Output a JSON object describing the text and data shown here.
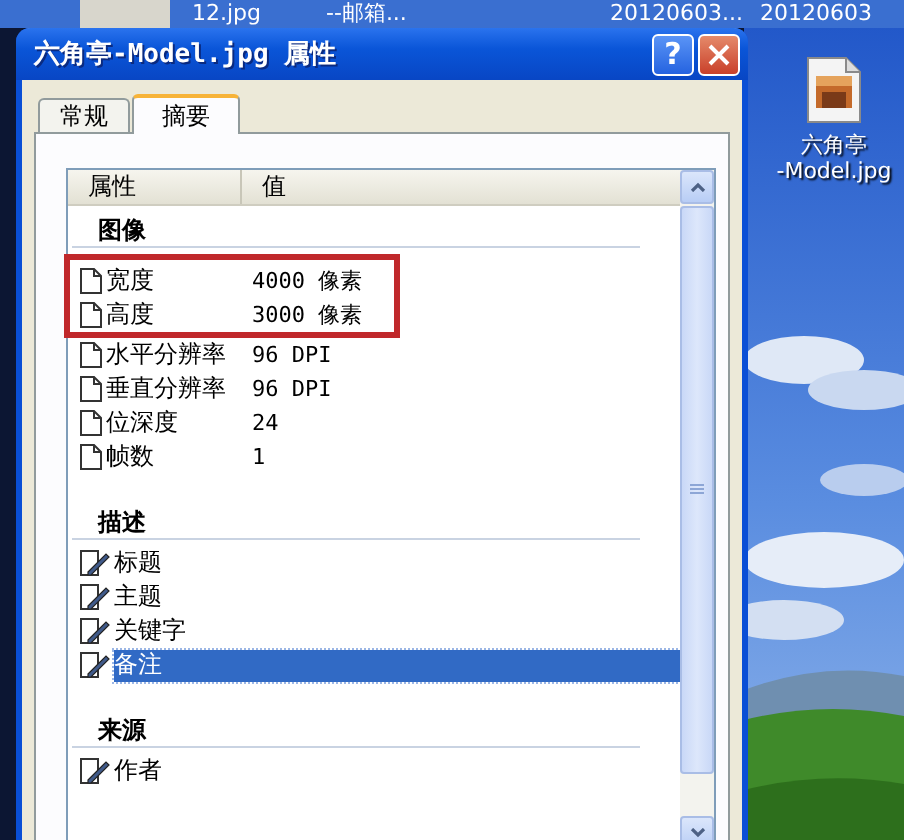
{
  "explorer_row": {
    "selected": true,
    "cells": [
      "12.jpg",
      "--邮箱...",
      "20120603...",
      "20120603"
    ]
  },
  "desktop_icon": {
    "label_lines": [
      "六角亭",
      "-Model.jpg"
    ]
  },
  "dialog": {
    "title": "六角亭-Model.jpg 属性",
    "help": "?",
    "tabs": [
      {
        "label": "常规",
        "selected": false
      },
      {
        "label": "摘要",
        "selected": true
      }
    ],
    "columns": [
      "属性",
      "值"
    ],
    "sections": [
      {
        "title": "图像",
        "rows": [
          {
            "kind": "readonly",
            "name": "宽度",
            "value": "4000 像素",
            "selected": false,
            "highlighted": true
          },
          {
            "kind": "readonly",
            "name": "高度",
            "value": "3000 像素",
            "selected": false,
            "highlighted": true
          },
          {
            "kind": "readonly",
            "name": "水平分辨率",
            "value": "96 DPI",
            "selected": false,
            "highlighted": false
          },
          {
            "kind": "readonly",
            "name": "垂直分辨率",
            "value": "96 DPI",
            "selected": false,
            "highlighted": false
          },
          {
            "kind": "readonly",
            "name": "位深度",
            "value": "24",
            "selected": false,
            "highlighted": false
          },
          {
            "kind": "readonly",
            "name": "帧数",
            "value": "1",
            "selected": false,
            "highlighted": false
          }
        ]
      },
      {
        "title": "描述",
        "rows": [
          {
            "kind": "editable",
            "name": "标题",
            "selected": false,
            "highlighted": false
          },
          {
            "kind": "editable",
            "name": "主题",
            "selected": false,
            "highlighted": false
          },
          {
            "kind": "editable",
            "name": "关键字",
            "selected": false,
            "highlighted": false
          },
          {
            "kind": "editable",
            "name": "备注",
            "selected": true,
            "highlighted": false
          }
        ]
      },
      {
        "title": "来源",
        "rows": [
          {
            "kind": "editable",
            "name": "作者",
            "selected": false,
            "highlighted": false
          }
        ]
      }
    ]
  }
}
